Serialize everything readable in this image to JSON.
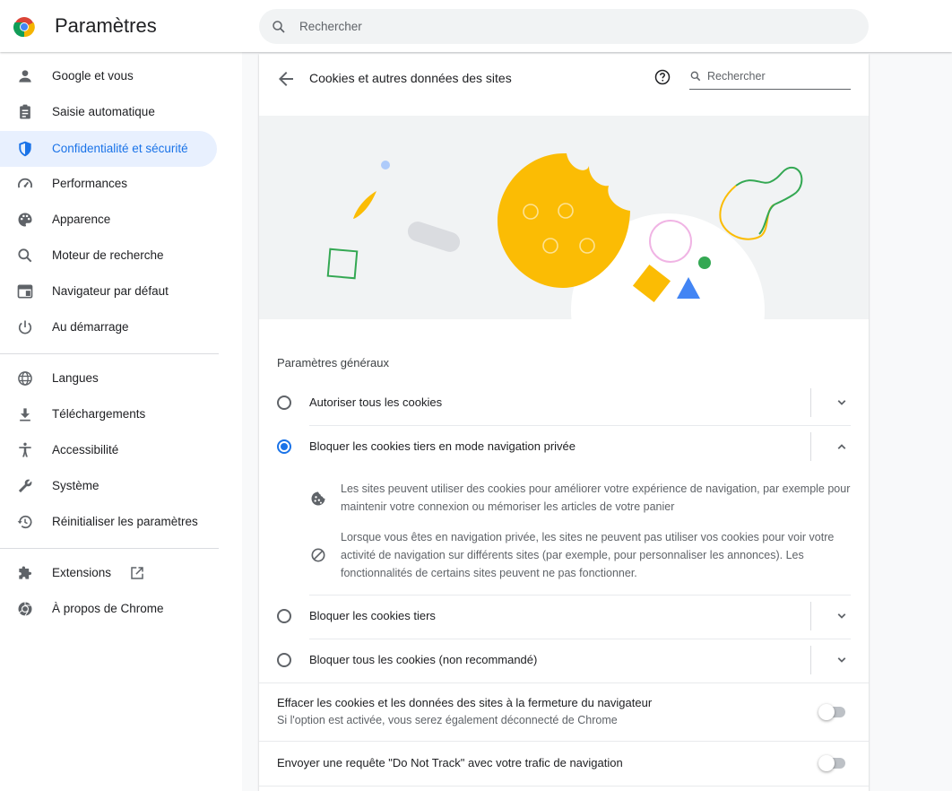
{
  "app": {
    "title": "Paramètres"
  },
  "search": {
    "placeholder": "Rechercher"
  },
  "sidebar": {
    "items": [
      {
        "label": "Google et vous",
        "icon": "person-icon"
      },
      {
        "label": "Saisie automatique",
        "icon": "clipboard-icon"
      },
      {
        "label": "Confidentialité et sécurité",
        "icon": "shield-icon",
        "active": true
      },
      {
        "label": "Performances",
        "icon": "speedometer-icon"
      },
      {
        "label": "Apparence",
        "icon": "palette-icon"
      },
      {
        "label": "Moteur de recherche",
        "icon": "search-icon"
      },
      {
        "label": "Navigateur par défaut",
        "icon": "browser-icon"
      },
      {
        "label": "Au démarrage",
        "icon": "power-icon"
      },
      {
        "label": "Langues",
        "icon": "globe-icon"
      },
      {
        "label": "Téléchargements",
        "icon": "download-icon"
      },
      {
        "label": "Accessibilité",
        "icon": "accessibility-icon"
      },
      {
        "label": "Système",
        "icon": "wrench-icon"
      },
      {
        "label": "Réinitialiser les paramètres",
        "icon": "restore-icon"
      },
      {
        "label": "Extensions",
        "icon": "puzzle-icon",
        "external": "external-link-icon"
      },
      {
        "label": "À propos de Chrome",
        "icon": "chrome-icon"
      }
    ]
  },
  "page": {
    "title": "Cookies et autres données des sites",
    "search_placeholder": "Rechercher",
    "section_title": "Paramètres généraux",
    "options": [
      {
        "label": "Autoriser tous les cookies",
        "selected": false,
        "expanded": false
      },
      {
        "label": "Bloquer les cookies tiers en mode navigation privée",
        "selected": true,
        "expanded": true
      },
      {
        "label": "Bloquer les cookies tiers",
        "selected": false,
        "expanded": false
      },
      {
        "label": "Bloquer tous les cookies (non recommandé)",
        "selected": false,
        "expanded": false
      }
    ],
    "details": [
      {
        "icon": "cookie-icon",
        "text": "Les sites peuvent utiliser des cookies pour améliorer votre expérience de navigation, par exemple pour maintenir votre connexion ou mémoriser les articles de votre panier"
      },
      {
        "icon": "block-icon",
        "text": "Lorsque vous êtes en navigation privée, les sites ne peuvent pas utiliser vos cookies pour voir votre activité de navigation sur différents sites (par exemple, pour personnaliser les annonces). Les fonctionnalités de certains sites peuvent ne pas fonctionner."
      }
    ],
    "clear_on_exit": {
      "label": "Effacer les cookies et les données des sites à la fermeture du navigateur",
      "sublabel": "Si l'option est activée, vous serez également déconnecté de Chrome",
      "enabled": false
    },
    "do_not_track": {
      "label": "Envoyer une requête \"Do Not Track\" avec votre trafic de navigation",
      "enabled": false
    }
  },
  "colors": {
    "accent": "#1a73e8",
    "active_bg": "#e8f0fe",
    "cookie": "#fbbc04"
  }
}
